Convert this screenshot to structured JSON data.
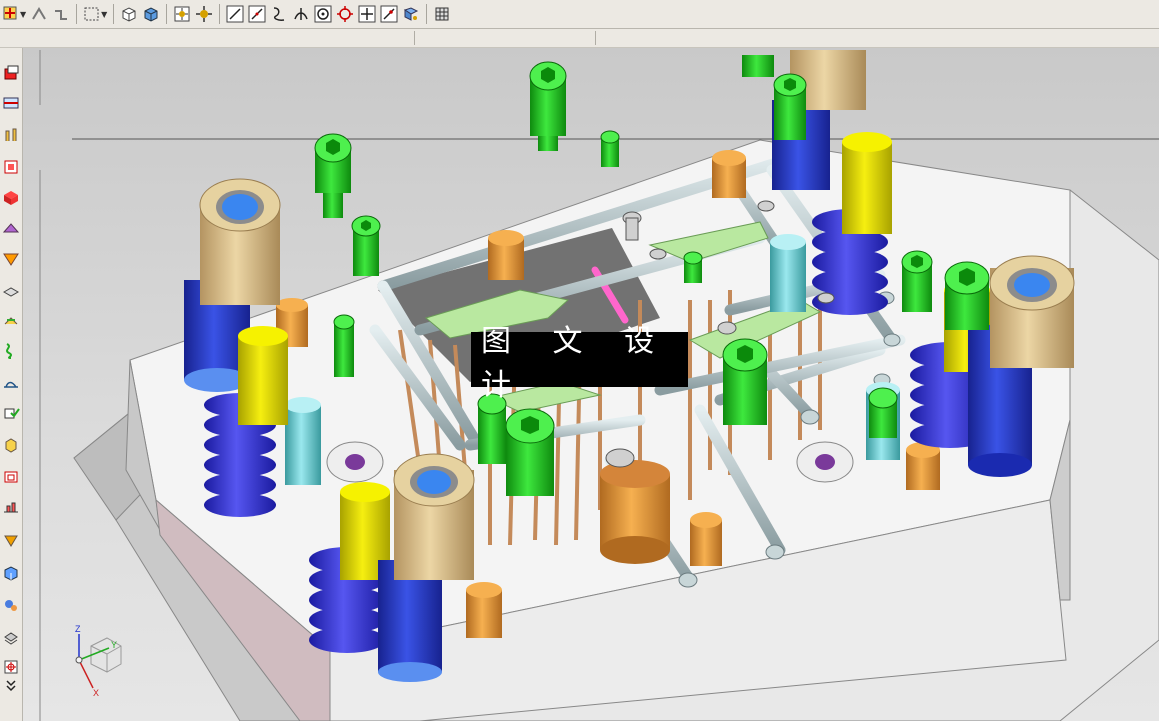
{
  "watermark": {
    "text": "图 文 设 计"
  },
  "toolbar": {
    "buttons": [
      {
        "name": "snap-point-icon"
      },
      {
        "name": "vertex-icon"
      },
      {
        "name": "edge-icon"
      },
      {
        "name": "select-box-icon"
      },
      {
        "name": "wireframe-view-icon"
      },
      {
        "name": "shaded-view-icon"
      },
      {
        "name": "snap-endpoint-icon"
      },
      {
        "name": "snap-midpoint-icon"
      },
      {
        "name": "line-icon"
      },
      {
        "name": "line-angle-icon"
      },
      {
        "name": "curve-icon"
      },
      {
        "name": "intersection-icon"
      },
      {
        "name": "circle-center-icon"
      },
      {
        "name": "quadrant-icon"
      },
      {
        "name": "crosshair-icon"
      },
      {
        "name": "point-on-curve-icon"
      },
      {
        "name": "face-point-icon"
      },
      {
        "name": "grid-icon"
      }
    ]
  },
  "sidebar": {
    "buttons": [
      "block-tool-icon",
      "split-tool-icon",
      "ejector-tool-icon",
      "cavity-layout-icon",
      "mold-base-icon",
      "standard-part-icon",
      "gate-icon",
      "slider-icon",
      "subinsert-icon",
      "cooling-icon",
      "runner-icon",
      "electrode-icon",
      "trim-tool-icon",
      "pocket-icon",
      "bom-icon",
      "drawing-icon",
      "cooling-channel-icon",
      "assembly-icon",
      "view-manager-icon",
      "delete-file-icon",
      "more-arrow-icon"
    ]
  },
  "triad": {
    "x_label": "X",
    "y_label": "Y",
    "z_label": "Z"
  },
  "colors": {
    "mold_plate": "#f3f3f3",
    "plate_shadow": "#bdbdbd",
    "bushing_tan": "#d9bf8c",
    "pillar_blue": "#2b3fc4",
    "spring_blue": "#3a3ad8",
    "bolt_green": "#1fc21f",
    "pin_yellow": "#e8e000",
    "ejector_pin": "#c48a5a",
    "support_orange": "#e8a040",
    "slider_green": "#b8e6a0",
    "cooling_pipe": "#b8c8cc",
    "sprue_pink": "#ff66cc"
  }
}
